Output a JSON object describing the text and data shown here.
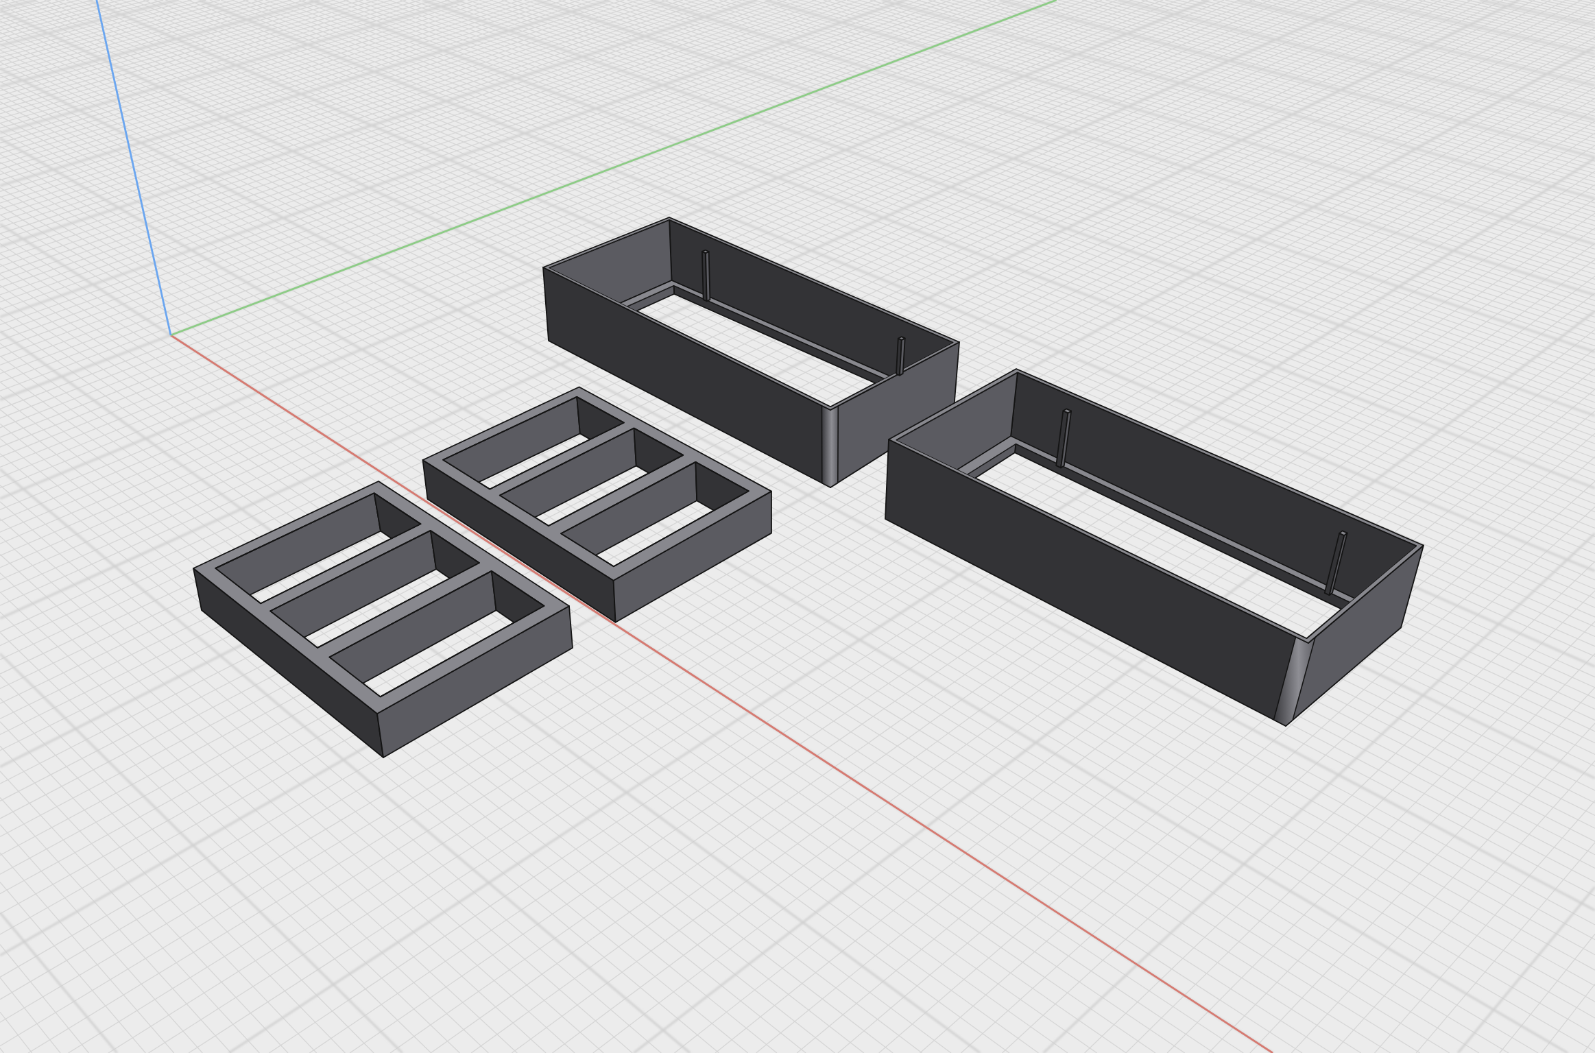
{
  "viewport": {
    "objects": [
      {
        "kind": "box"
      },
      {
        "kind": "box"
      },
      {
        "kind": "tray"
      },
      {
        "kind": "tray"
      }
    ]
  }
}
